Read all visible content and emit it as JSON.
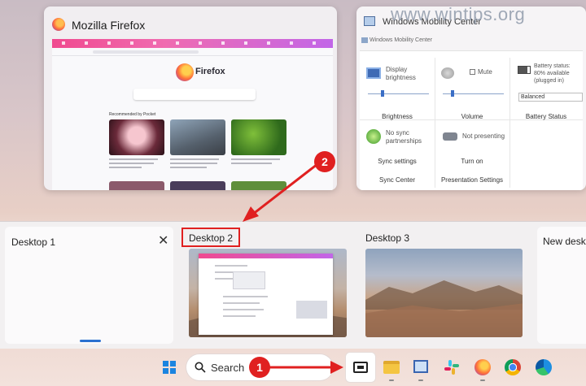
{
  "watermark": "www.wintips.org",
  "firefox_window": {
    "title": "Mozilla Firefox",
    "brand": "Firefox",
    "pocket_heading": "Recommended by Pocket"
  },
  "mobility_window": {
    "title": "Windows Mobility Center",
    "subtitle": "Windows Mobility Center",
    "tiles": {
      "display_text": "Display brightness",
      "brightness_label": "Brightness",
      "mute_text": "Mute",
      "volume_label": "Volume",
      "battery_text": "Battery status: 80% available (plugged in)",
      "battery_select": "Balanced",
      "battery_label": "Battery Status",
      "sync_text": "No sync partnerships",
      "sync_button": "Sync settings",
      "sync_label": "Sync Center",
      "presenting_text": "Not presenting",
      "presenting_button": "Turn on",
      "presenting_label": "Presentation Settings"
    }
  },
  "desktops": {
    "desktop1": "Desktop 1",
    "desktop2": "Desktop 2",
    "desktop3": "Desktop 3",
    "new_desktop": "New desktop"
  },
  "annotations": {
    "badge1": "1",
    "badge2": "2",
    "accent": "#e02020"
  },
  "taskbar": {
    "search_label": "Search",
    "icons": [
      "windows-start-icon",
      "search-icon",
      "task-view-icon",
      "file-explorer-icon",
      "mobility-center-icon",
      "slack-icon",
      "firefox-icon",
      "chrome-icon",
      "edge-icon"
    ]
  }
}
